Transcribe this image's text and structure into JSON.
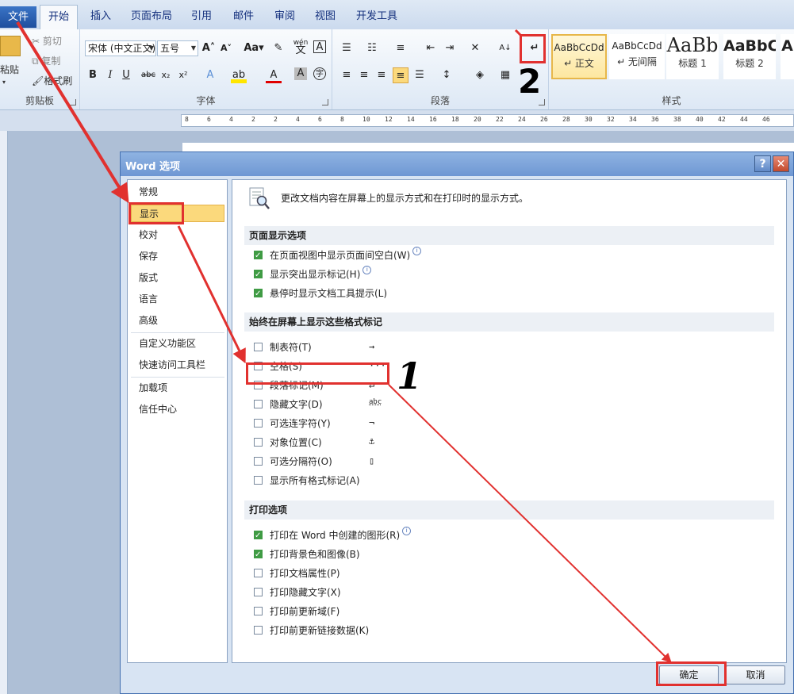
{
  "tabs": [
    "文件",
    "开始",
    "插入",
    "页面布局",
    "引用",
    "邮件",
    "审阅",
    "视图",
    "开发工具"
  ],
  "ribbon": {
    "clipboard": {
      "label": "剪贴板",
      "paste": "粘贴",
      "cut": "剪切",
      "copy": "复制",
      "format_painter": "格式刷"
    },
    "font": {
      "label": "字体",
      "font_name": "宋体 (中文正文)",
      "font_size": "五号",
      "aa": "Aa",
      "wen": "wén",
      "wen_char": "文",
      "a": "A"
    },
    "paragraph": {
      "label": "段落"
    },
    "styles": {
      "label": "样式",
      "items": [
        {
          "sample": "AaBbCcDd",
          "name": "↵ 正文"
        },
        {
          "sample": "AaBbCcDd",
          "name": "↵ 无间隔"
        },
        {
          "sample": "AaBb",
          "name": "标题 1"
        },
        {
          "sample": "AaBbC",
          "name": "标题 2"
        },
        {
          "sample": "A",
          "name": ""
        }
      ]
    }
  },
  "ruler_numbers": [
    "8",
    "6",
    "4",
    "2",
    "2",
    "4",
    "6",
    "8",
    "10",
    "12",
    "14",
    "16",
    "18",
    "20",
    "22",
    "24",
    "26",
    "28",
    "30",
    "32",
    "34",
    "36",
    "38",
    "40",
    "42",
    "44",
    "46"
  ],
  "dialog": {
    "title": "Word 选项",
    "help": "?",
    "close": "✕",
    "nav": [
      "常规",
      "显示",
      "校对",
      "保存",
      "版式",
      "语言",
      "高级",
      "自定义功能区",
      "快速访问工具栏",
      "加载项",
      "信任中心"
    ],
    "header": "更改文档内容在屏幕上的显示方式和在打印时的显示方式。",
    "section_page": "页面显示选项",
    "page_options": [
      {
        "label": "在页面视图中显示页面间空白(W)",
        "checked": true,
        "info": true
      },
      {
        "label": "显示突出显示标记(H)",
        "checked": true,
        "info": true
      },
      {
        "label": "悬停时显示文档工具提示(L)",
        "checked": true,
        "info": false
      }
    ],
    "section_marks": "始终在屏幕上显示这些格式标记",
    "marks": [
      {
        "label": "制表符(T)",
        "symbol": "→",
        "checked": false
      },
      {
        "label": "空格(S)",
        "symbol": "···",
        "checked": false
      },
      {
        "label": "段落标记(M)",
        "symbol": "↵",
        "checked": false
      },
      {
        "label": "隐藏文字(D)",
        "symbol": "abc",
        "checked": false
      },
      {
        "label": "可选连字符(Y)",
        "symbol": "¬",
        "checked": false
      },
      {
        "label": "对象位置(C)",
        "symbol": "⚓",
        "checked": false
      },
      {
        "label": "可选分隔符(O)",
        "symbol": "▯",
        "checked": false
      },
      {
        "label": "显示所有格式标记(A)",
        "symbol": "",
        "checked": false
      }
    ],
    "section_print": "打印选项",
    "print_options": [
      {
        "label": "打印在 Word 中创建的图形(R)",
        "checked": true,
        "info": true
      },
      {
        "label": "打印背景色和图像(B)",
        "checked": true,
        "info": false
      },
      {
        "label": "打印文档属性(P)",
        "checked": false,
        "info": false
      },
      {
        "label": "打印隐藏文字(X)",
        "checked": false,
        "info": false
      },
      {
        "label": "打印前更新域(F)",
        "checked": false,
        "info": false
      },
      {
        "label": "打印前更新链接数据(K)",
        "checked": false,
        "info": false
      }
    ],
    "ok": "确定",
    "cancel": "取消"
  },
  "annotations": {
    "step1": "1",
    "step2": "2",
    "color": "#e1312f"
  }
}
